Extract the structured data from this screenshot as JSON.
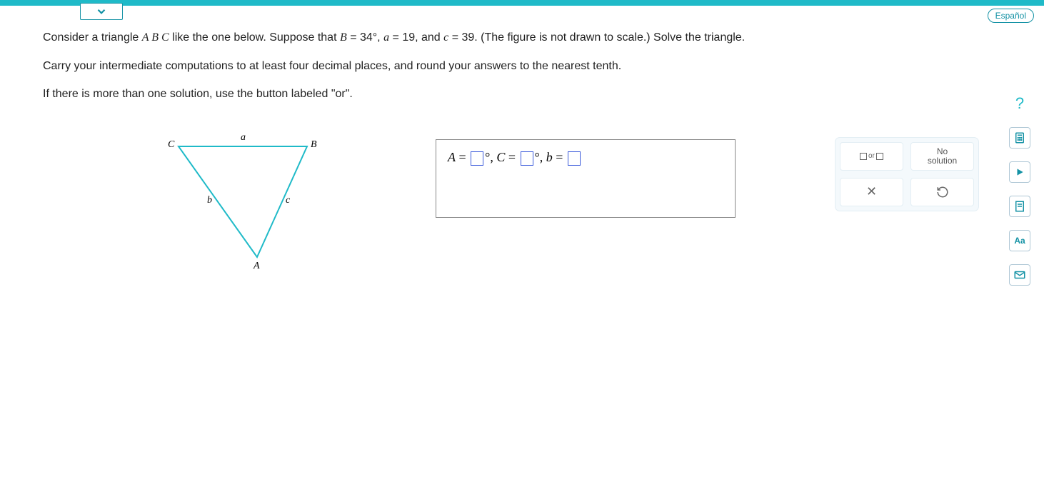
{
  "topbar": {
    "espanol": "Español"
  },
  "problem": {
    "line1_prefix": "Consider a triangle ",
    "line1_tri": "A B C",
    "line1_mid": " like the one below. Suppose that ",
    "line1_B": "B",
    "line1_Bval": " = 34°, ",
    "line1_a": "a",
    "line1_aval": " = 19, and ",
    "line1_c": "c",
    "line1_cval": " = 39. ",
    "line1_suffix": "(The figure is not drawn to scale.) Solve the triangle.",
    "line2": "Carry your intermediate computations to at least four decimal places, and round your answers to the nearest tenth.",
    "line3": "If there is more than one solution, use the button labeled \"or\"."
  },
  "triangle": {
    "A": "A",
    "B": "B",
    "C": "C",
    "a": "a",
    "b": "b",
    "c": "c"
  },
  "answer": {
    "A_lbl": "A",
    "eq": " = ",
    "deg": "°",
    "sep": ", ",
    "C_lbl": "C",
    "b_lbl": "b",
    "values": {
      "A": "",
      "C": "",
      "b": ""
    }
  },
  "tools": {
    "or": "or",
    "no_solution_l1": "No",
    "no_solution_l2": "solution"
  },
  "chart_data": {
    "type": "table",
    "given": {
      "B_deg": 34,
      "a": 19,
      "c": 39
    },
    "unknowns": [
      "A_deg",
      "C_deg",
      "b"
    ],
    "note": "figure not to scale"
  }
}
